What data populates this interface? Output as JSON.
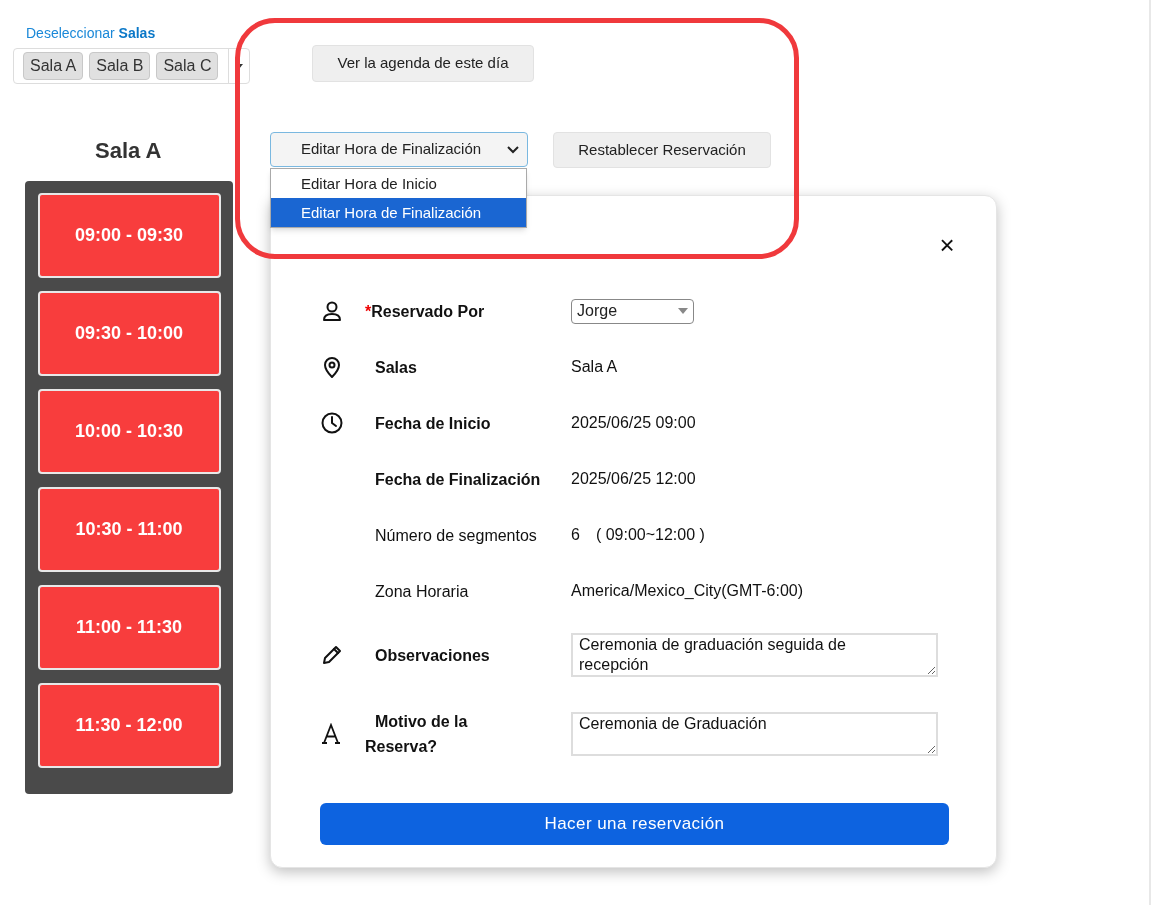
{
  "deselect_link": {
    "text": "Deseleccionar",
    "bold_text": "Salas"
  },
  "room_tags": [
    "Sala A",
    "Sala B",
    "Sala C"
  ],
  "room_title": "Sala A",
  "time_slots": [
    {
      "label": "09:00 - 09:30",
      "booked": true
    },
    {
      "label": "09:30 - 10:00",
      "booked": true
    },
    {
      "label": "10:00 - 10:30",
      "booked": true
    },
    {
      "label": "10:30 - 11:00",
      "booked": true
    },
    {
      "label": "11:00 - 11:30",
      "booked": true
    },
    {
      "label": "11:30 - 12:00",
      "booked": true
    }
  ],
  "agenda_button": "Ver la agenda de este día",
  "edit_mode_select": {
    "value": "Editar Hora de Finalización",
    "expanded": true,
    "options": [
      {
        "label": "Editar Hora de Inicio",
        "selected": false
      },
      {
        "label": "Editar Hora de Finalización",
        "selected": true
      }
    ]
  },
  "reset_button": "Restablecer Reservación",
  "reservation_form": {
    "close": "×",
    "fields": [
      {
        "label": "Reservado Por",
        "required_mark": "*",
        "emphasized": true,
        "kind": "select",
        "value": "Jorge"
      },
      {
        "label": "Salas",
        "emphasized": true,
        "kind": "text",
        "value": "Sala A"
      },
      {
        "label": "Fecha de Inicio",
        "emphasized": true,
        "kind": "text",
        "value": "2025/06/25 09:00"
      },
      {
        "label": "Fecha de Finalización",
        "emphasized": true,
        "kind": "text",
        "value": "2025/06/25 12:00"
      },
      {
        "label": "Número de segmentos",
        "emphasized": false,
        "kind": "text",
        "value": "6",
        "detail": "( 09:00~12:00 )"
      },
      {
        "label": "Zona Horaria",
        "emphasized": false,
        "kind": "text",
        "value": "America/Mexico_City(GMT-6:00)"
      },
      {
        "label": "Observaciones",
        "emphasized": true,
        "kind": "textarea",
        "value": "Ceremonia de graduación seguida de recepción"
      },
      {
        "label": "Motivo de la Reserva?",
        "emphasized": true,
        "kind": "textarea",
        "value": "Ceremonia de Graduación"
      }
    ],
    "submit_button": "Hacer una reservación"
  }
}
